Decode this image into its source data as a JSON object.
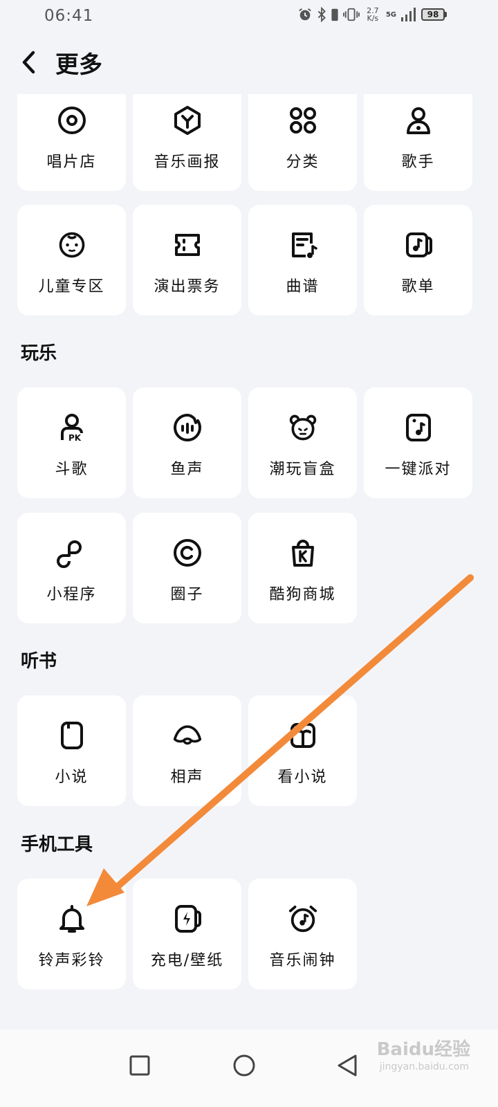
{
  "status": {
    "time": "06:41",
    "net_speed_value": "2.7",
    "net_speed_unit": "K/s",
    "signal_label": "5G",
    "battery": "98"
  },
  "header": {
    "title": "更多"
  },
  "grid_top": [
    {
      "label": "唱片店",
      "icon": "vinyl-icon"
    },
    {
      "label": "音乐画报",
      "icon": "hexagon-y-icon"
    },
    {
      "label": "分类",
      "icon": "grid-dots-icon"
    },
    {
      "label": "歌手",
      "icon": "singer-icon"
    },
    {
      "label": "儿童专区",
      "icon": "baby-face-icon"
    },
    {
      "label": "演出票务",
      "icon": "ticket-icon"
    },
    {
      "label": "曲谱",
      "icon": "music-sheet-icon"
    },
    {
      "label": "歌单",
      "icon": "playlist-icon"
    }
  ],
  "sections": [
    {
      "title": "玩乐",
      "items": [
        {
          "label": "斗歌",
          "icon": "pk-user-icon"
        },
        {
          "label": "鱼声",
          "icon": "fish-voice-icon"
        },
        {
          "label": "潮玩盲盒",
          "icon": "bear-face-icon"
        },
        {
          "label": "一键派对",
          "icon": "party-icon"
        },
        {
          "label": "小程序",
          "icon": "mini-program-icon"
        },
        {
          "label": "圈子",
          "icon": "circle-c-icon"
        },
        {
          "label": "酷狗商城",
          "icon": "shopping-bag-icon"
        }
      ]
    },
    {
      "title": "听书",
      "items": [
        {
          "label": "小说",
          "icon": "book-icon"
        },
        {
          "label": "相声",
          "icon": "fan-icon"
        },
        {
          "label": "看小说",
          "icon": "open-book-icon"
        }
      ]
    },
    {
      "title": "手机工具",
      "items": [
        {
          "label": "铃声彩铃",
          "icon": "bell-icon"
        },
        {
          "label": "充电/壁纸",
          "icon": "charging-icon"
        },
        {
          "label": "音乐闹钟",
          "icon": "alarm-clock-icon"
        }
      ]
    }
  ],
  "watermark": {
    "text": "Baidu经验",
    "sub": "jingyan.baidu.com"
  },
  "colors": {
    "arrow": "#f28a3a",
    "background": "#f3f4f8",
    "card": "#ffffff"
  }
}
